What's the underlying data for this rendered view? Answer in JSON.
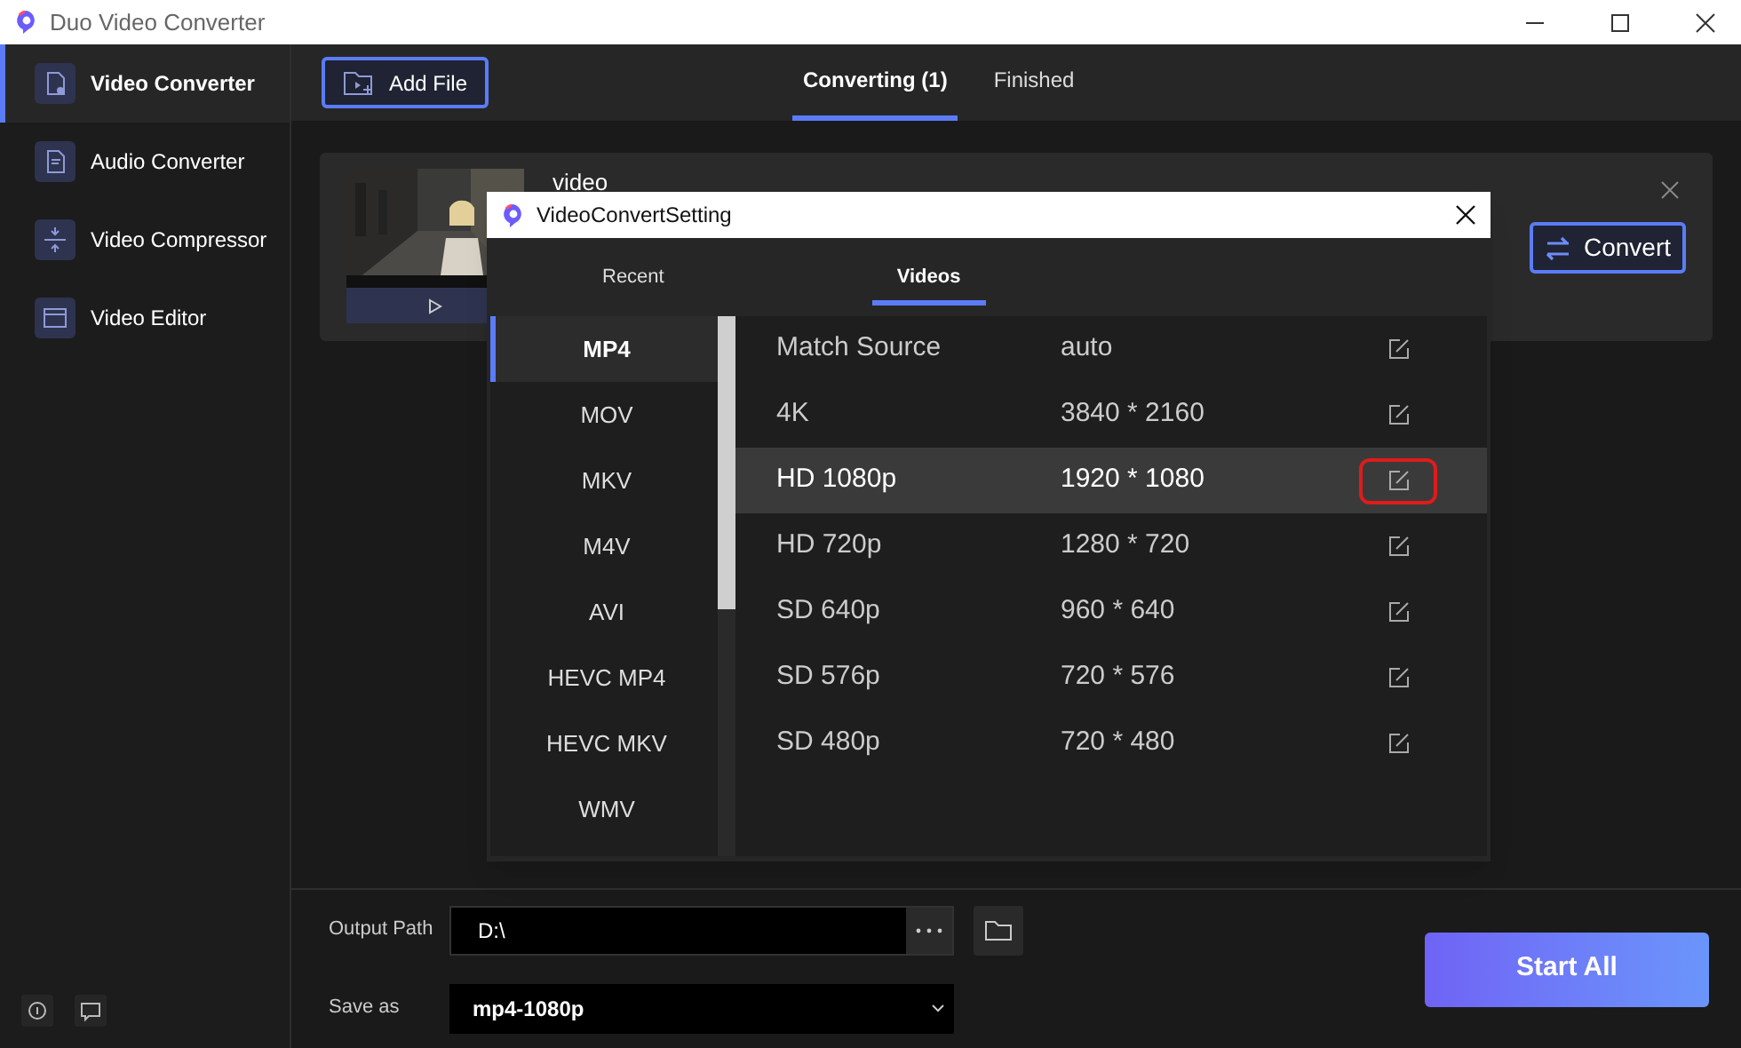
{
  "window": {
    "title": "Duo Video Converter"
  },
  "sidebar": {
    "items": [
      {
        "label": "Video Converter",
        "selected": true,
        "kind": "video"
      },
      {
        "label": "Audio Converter",
        "selected": false,
        "kind": "audio"
      },
      {
        "label": "Video Compressor",
        "selected": false,
        "kind": "compress"
      },
      {
        "label": "Video Editor",
        "selected": false,
        "kind": "editor"
      }
    ]
  },
  "toolbar": {
    "add_file": "Add File",
    "tabs": [
      {
        "label": "Converting (1)",
        "selected": true
      },
      {
        "label": "Finished",
        "selected": false
      }
    ]
  },
  "file_card": {
    "name": "video",
    "convert": "Convert"
  },
  "dialog": {
    "title": "VideoConvertSetting",
    "tabs": [
      {
        "label": "Recent",
        "selected": false
      },
      {
        "label": "Videos",
        "selected": true
      }
    ],
    "formats": [
      {
        "label": "MP4",
        "selected": true
      },
      {
        "label": "MOV",
        "selected": false
      },
      {
        "label": "MKV",
        "selected": false
      },
      {
        "label": "M4V",
        "selected": false
      },
      {
        "label": "AVI",
        "selected": false
      },
      {
        "label": "HEVC MP4",
        "selected": false
      },
      {
        "label": "HEVC MKV",
        "selected": false
      },
      {
        "label": "WMV",
        "selected": false
      }
    ],
    "presets": [
      {
        "name": "Match Source",
        "resolution": "auto",
        "selected": false,
        "highlighted": false
      },
      {
        "name": "4K",
        "resolution": "3840 * 2160",
        "selected": false,
        "highlighted": false
      },
      {
        "name": "HD 1080p",
        "resolution": "1920 * 1080",
        "selected": true,
        "highlighted": true
      },
      {
        "name": "HD 720p",
        "resolution": "1280 * 720",
        "selected": false,
        "highlighted": false
      },
      {
        "name": "SD 640p",
        "resolution": "960 * 640",
        "selected": false,
        "highlighted": false
      },
      {
        "name": "SD 576p",
        "resolution": "720 * 576",
        "selected": false,
        "highlighted": false
      },
      {
        "name": "SD 480p",
        "resolution": "720 * 480",
        "selected": false,
        "highlighted": false
      }
    ]
  },
  "output": {
    "path_label": "Output Path",
    "path": "D:\\",
    "save_as_label": "Save as",
    "save_as": "mp4-1080p"
  },
  "start_all": "Start All"
}
